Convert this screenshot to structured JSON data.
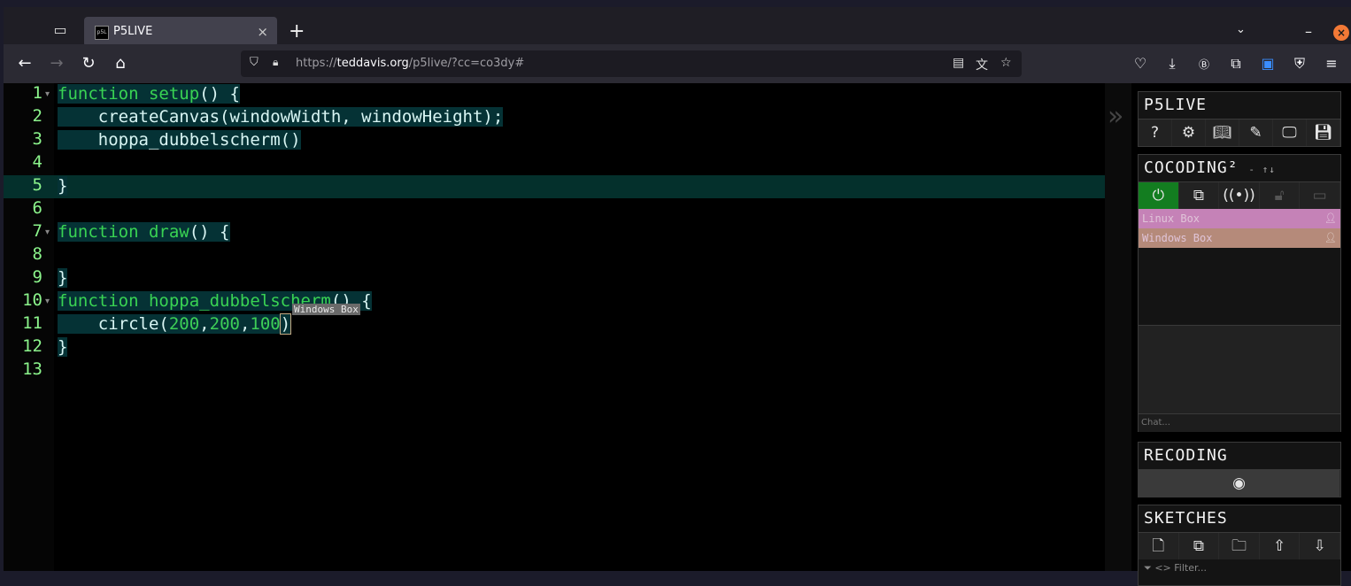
{
  "browser": {
    "tab_title": "P5LIVE",
    "tab_favicon_text": "p5L",
    "url_host": "teddavis.org",
    "url_prefix": "https://",
    "url_path": "/p5live/?cc=co3dy#",
    "new_tab_label": "+",
    "close_tab_label": "×"
  },
  "editor": {
    "line_numbers": [
      "1",
      "2",
      "3",
      "4",
      "5",
      "6",
      "7",
      "8",
      "9",
      "10",
      "11",
      "12",
      "13"
    ],
    "lines": [
      "function setup() {",
      "    createCanvas(windowWidth, windowHeight);",
      "    hoppa_dubbelscherm()",
      "",
      "}",
      "",
      "function draw() {",
      "",
      "}",
      "function hoppa_dubbelscherm() {",
      "    circle(200,200,100)",
      "}",
      ""
    ],
    "remote_cursor_label": "Windows Box"
  },
  "panel": {
    "p5live_title": "P5LIVE",
    "cocoding_title": "COCODING²",
    "cocoding_extras": "- ↑↓",
    "users": [
      {
        "name": "Linux Box",
        "color": "#c582b7"
      },
      {
        "name": "Windows Box",
        "color": "#b58a7a"
      }
    ],
    "chat_placeholder": "Chat...",
    "recoding_title": "RECODING",
    "sketches_title": "SKETCHES",
    "filter_placeholder": "Filter..."
  }
}
